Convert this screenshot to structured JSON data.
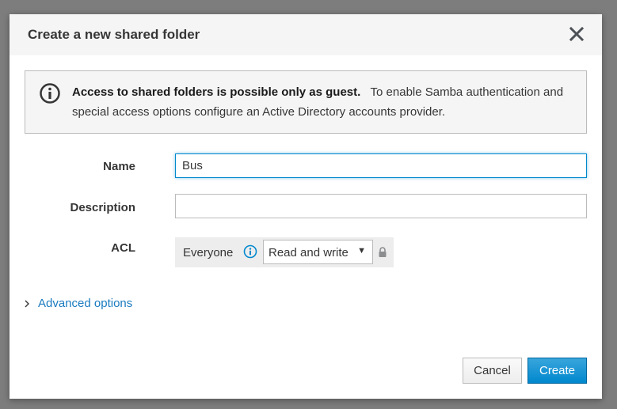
{
  "dialog": {
    "title": "Create a new shared folder"
  },
  "alert": {
    "icon": "info-icon",
    "strong_text": "Access to shared folders is possible only as guest.",
    "text": "To enable Samba authentication and special access options configure an Active Directory accounts provider."
  },
  "form": {
    "name_label": "Name",
    "name_value": "Bus",
    "description_label": "Description",
    "description_value": "",
    "acl_label": "ACL",
    "acl_principal": "Everyone",
    "acl_permission": "Read and write"
  },
  "advanced": {
    "label": "Advanced options"
  },
  "buttons": {
    "cancel": "Cancel",
    "create": "Create"
  },
  "colors": {
    "primary": "#0088ce",
    "link": "#1a7bbf",
    "text": "#363636"
  }
}
